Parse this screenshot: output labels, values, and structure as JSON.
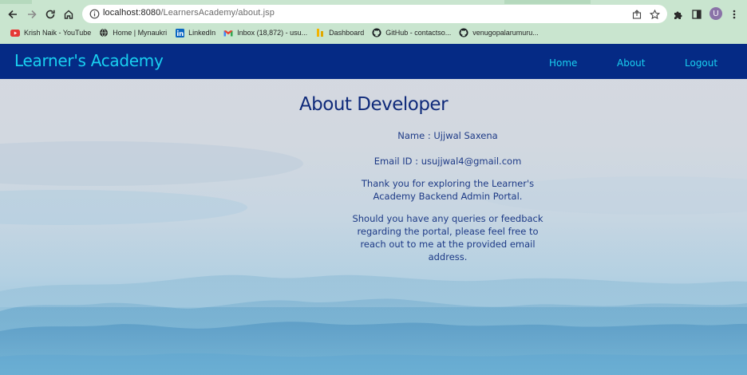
{
  "browser": {
    "url_host": "localhost:8080",
    "url_path": "/LearnersAcademy/about.jsp",
    "avatar_letter": "U",
    "bookmarks": [
      {
        "label": "Krish Naik - YouTube",
        "icon": "youtube-icon"
      },
      {
        "label": "Home | Mynaukri",
        "icon": "globe-icon"
      },
      {
        "label": "LinkedIn",
        "icon": "linkedin-icon"
      },
      {
        "label": "Inbox (18,872) - usu...",
        "icon": "gmail-icon"
      },
      {
        "label": "Dashboard",
        "icon": "dashboard-icon"
      },
      {
        "label": "GitHub - contactso...",
        "icon": "github-icon"
      },
      {
        "label": "venugopalarumuru...",
        "icon": "github-icon"
      }
    ]
  },
  "navbar": {
    "brand": "Learner's Academy",
    "links": [
      "Home",
      "About",
      "Logout"
    ]
  },
  "main": {
    "heading": "About Developer",
    "name_line": "Name : Ujjwal Saxena",
    "email_line": "Email ID : usujjwal4@gmail.com",
    "thanks_line": "Thank you for exploring the Learner's Academy Backend Admin Portal.",
    "queries_line": "Should you have any queries or feedback regarding the portal, please feel free to reach out to me at the provided email address."
  },
  "colors": {
    "navbar_bg": "#052a85",
    "brand_color": "#19d0f0",
    "text_color": "#1d3a86"
  }
}
